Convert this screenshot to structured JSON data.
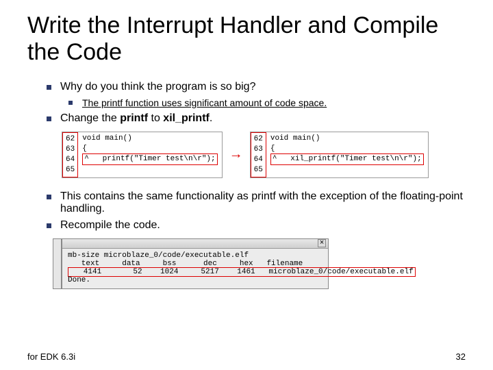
{
  "title": "Write the Interrupt Handler and Compile the Code",
  "bullets": {
    "b1": "Why do you think the program is so big?",
    "b1a": "The printf function uses significant amount of code space.",
    "b2_pre": "Change the ",
    "b2_kw1": "printf",
    "b2_mid": " to ",
    "b2_kw2": "xil_printf",
    "b2_post": ".",
    "b3": "This contains the same functionality as printf with the exception of the floating-point handling.",
    "b4": "Recompile the code."
  },
  "code_left": {
    "lines": [
      "62",
      "63",
      "64",
      "65"
    ],
    "l1": "void main()",
    "l2": "{",
    "l3": "^   printf(\"Timer test\\n\\r\");"
  },
  "code_right": {
    "lines": [
      "62",
      "63",
      "64",
      "65"
    ],
    "l1": "void main()",
    "l2": "{",
    "l3": "^   xil_printf(\"Timer test\\n\\r\");"
  },
  "terminal": {
    "cmd": "mb-size microblaze_0/code/executable.elf",
    "hdr": "   text     data     bss      dec     hex   filename",
    "row": "   4141       52    1024     5217    1461   microblaze_0/code/executable.elf",
    "done": "Done."
  },
  "footer_left": "for EDK 6.3i",
  "footer_right": "32"
}
